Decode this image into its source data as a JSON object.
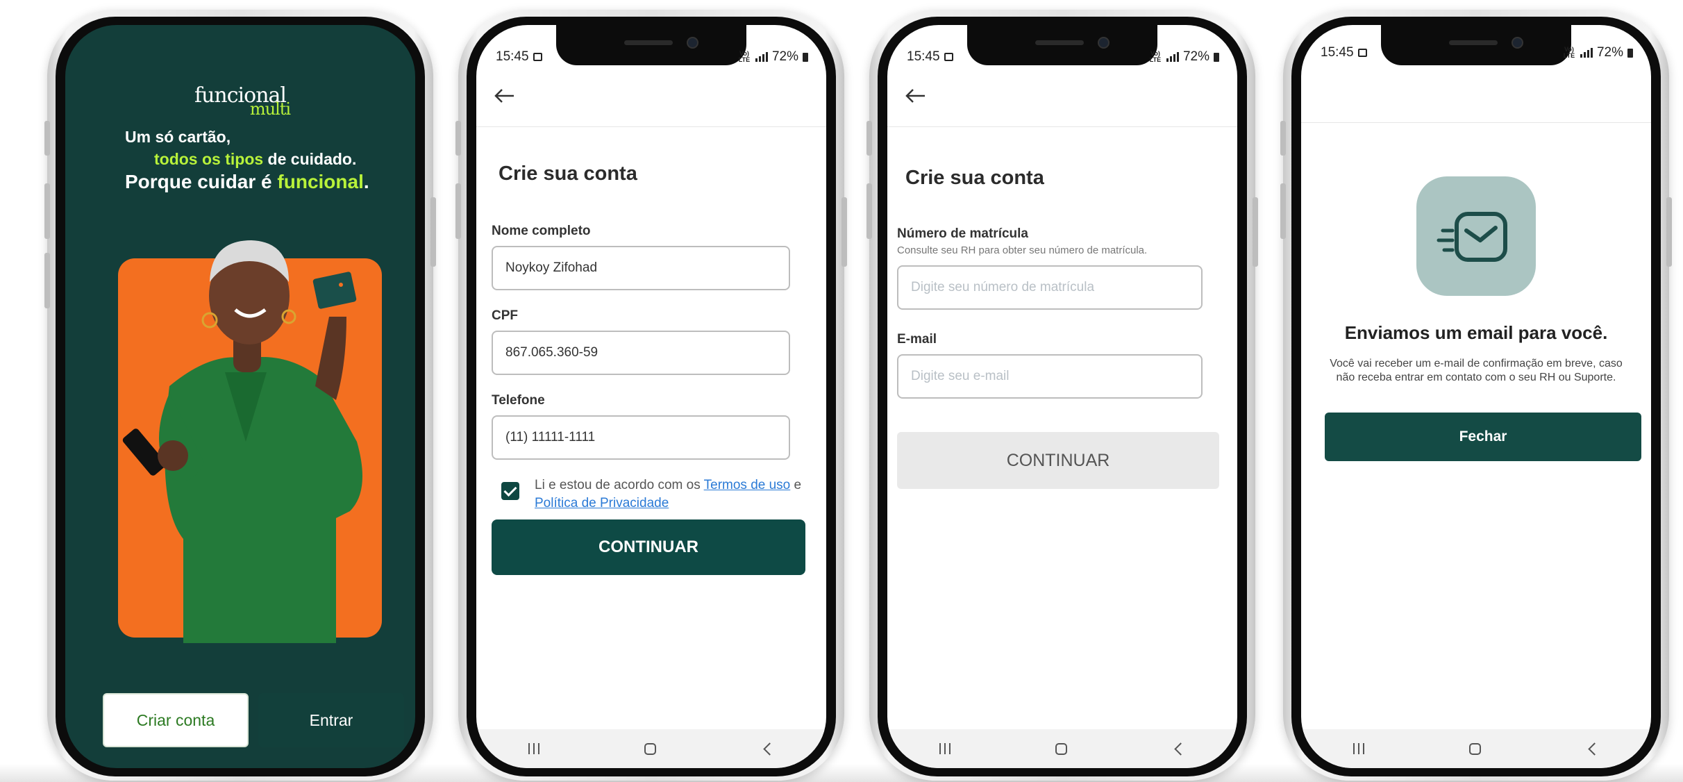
{
  "colors": {
    "brand_dark": "#133e3a",
    "brand_lime": "#b8f23a",
    "accent_orange": "#f36f20",
    "button_primary": "#0e4a45",
    "link": "#2a7ad6"
  },
  "status_bar": {
    "time": "15:45",
    "network": "Vo) LTE",
    "battery": "72%"
  },
  "welcome": {
    "logo_word": "funcional",
    "logo_sub": "multi",
    "tagline_line1": "Um só cartão,",
    "tagline_line2_highlight": "todos os tipos",
    "tagline_line2_rest": " de cuidado.",
    "tagline_line3_start": "Porque cuidar é ",
    "tagline_line3_highlight": "funcional",
    "tagline_line3_end": ".",
    "create_account_label": "Criar conta",
    "login_label": "Entrar"
  },
  "signup_step1": {
    "title": "Crie sua conta",
    "full_name_label": "Nome completo",
    "full_name_value": "Noykoy Zifohad",
    "cpf_label": "CPF",
    "cpf_value": "867.065.360-59",
    "phone_label": "Telefone",
    "phone_value": "(11) 11111-1111",
    "terms_checked": true,
    "agree_prefix": "Li e estou de acordo com os ",
    "terms_link": "Termos de uso",
    "agree_and": " e",
    "privacy_link": "Política de Privacidade",
    "continue_label": "CONTINUAR"
  },
  "signup_step2": {
    "title": "Crie sua conta",
    "registration_label": "Número de matrícula",
    "registration_hint": "Consulte seu RH para obter seu número de matrícula.",
    "registration_placeholder": "Digite seu número de matrícula",
    "email_label": "E-mail",
    "email_placeholder": "Digite seu e-mail",
    "continue_label": "CONTINUAR"
  },
  "email_sent": {
    "title": "Enviamos um email para você.",
    "description": "Você vai receber um e-mail de confirmação em breve, caso não receba entrar em contato com o seu RH ou Suporte.",
    "close_label": "Fechar"
  },
  "icons": [
    "back-arrow-icon",
    "envelope-icon",
    "gallery-icon",
    "signal-icon",
    "battery-icon",
    "recent-apps-icon",
    "home-icon",
    "nav-back-icon",
    "checkbox-checked-icon"
  ]
}
